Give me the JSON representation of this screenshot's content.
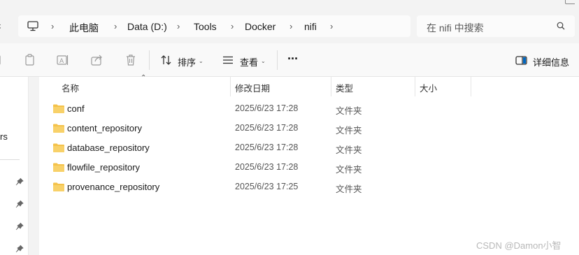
{
  "address_bar": {
    "left_fragment": "ε",
    "breadcrumbs": [
      "此电脑",
      "Data (D:)",
      "Tools",
      "Docker",
      "nifi"
    ],
    "search_placeholder": "在 nifi 中搜索"
  },
  "command_bar": {
    "sort_label": "排序",
    "view_label": "查看",
    "more_label": "···",
    "details_label": "详细信息",
    "icons": [
      "copy-icon",
      "rename-icon",
      "share-icon",
      "delete-icon",
      "sort-icon",
      "view-icon",
      "details-pane-icon"
    ]
  },
  "nav_pane": {
    "fragment_text": "rs",
    "pinned_count": 4
  },
  "file_list": {
    "columns": [
      "名称",
      "修改日期",
      "类型",
      "大小"
    ],
    "rows": [
      {
        "name": "conf",
        "date": "2025/6/23 17:28",
        "type": "文件夹"
      },
      {
        "name": "content_repository",
        "date": "2025/6/23 17:28",
        "type": "文件夹"
      },
      {
        "name": "database_repository",
        "date": "2025/6/23 17:28",
        "type": "文件夹"
      },
      {
        "name": "flowfile_repository",
        "date": "2025/6/23 17:28",
        "type": "文件夹"
      },
      {
        "name": "provenance_repository",
        "date": "2025/6/23 17:25",
        "type": "文件夹"
      }
    ]
  },
  "watermark": "CSDN @Damon小智",
  "colors": {
    "folder": "#f4c24a",
    "accent": "#0067c0"
  }
}
